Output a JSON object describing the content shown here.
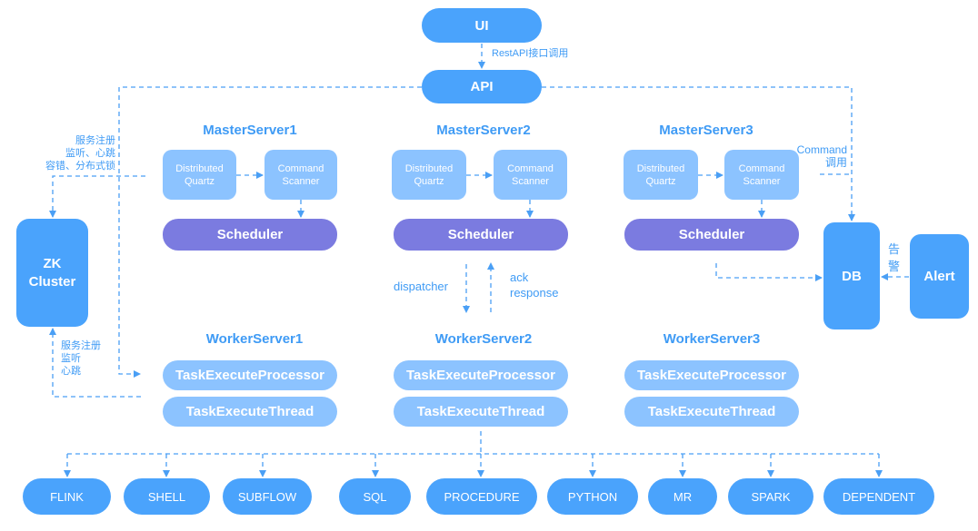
{
  "ui": "UI",
  "api": "API",
  "restapi_label": "RestAPI接口调用",
  "zk": {
    "line1": "ZK",
    "line2": "Cluster"
  },
  "zk_master_label": [
    "服务注册",
    "监听、心跳",
    "容错、分布式锁"
  ],
  "zk_worker_label": [
    "服务注册",
    "监听",
    "心跳"
  ],
  "masters": [
    {
      "title": "MasterServer1",
      "quartz": [
        "Distributed",
        "Quartz"
      ],
      "scanner": [
        "Command",
        "Scanner"
      ],
      "scheduler": "Scheduler"
    },
    {
      "title": "MasterServer2",
      "quartz": [
        "Distributed",
        "Quartz"
      ],
      "scanner": [
        "Command",
        "Scanner"
      ],
      "scheduler": "Scheduler"
    },
    {
      "title": "MasterServer3",
      "quartz": [
        "Distributed",
        "Quartz"
      ],
      "scanner": [
        "Command",
        "Scanner"
      ],
      "scheduler": "Scheduler"
    }
  ],
  "workers": [
    {
      "title": "WorkerServer1",
      "processor": "TaskExecuteProcessor",
      "thread": "TaskExecuteThread"
    },
    {
      "title": "WorkerServer2",
      "processor": "TaskExecuteProcessor",
      "thread": "TaskExecuteThread"
    },
    {
      "title": "WorkerServer3",
      "processor": "TaskExecuteProcessor",
      "thread": "TaskExecuteThread"
    }
  ],
  "dispatcher_label": "dispatcher",
  "ack_label": [
    "ack",
    "response"
  ],
  "command_call_label": [
    "Command",
    "调用"
  ],
  "db": "DB",
  "alert": "Alert",
  "alert_label": [
    "告",
    "警"
  ],
  "task_types": [
    "FLINK",
    "SHELL",
    "SUBFLOW",
    "SQL",
    "PROCEDURE",
    "PYTHON",
    "MR",
    "SPARK",
    "DEPENDENT"
  ],
  "colors": {
    "node": "#4aa3fc",
    "sub_node": "#8cc3ff",
    "scheduler": "#7b7be0",
    "line": "#4a9ff5"
  }
}
